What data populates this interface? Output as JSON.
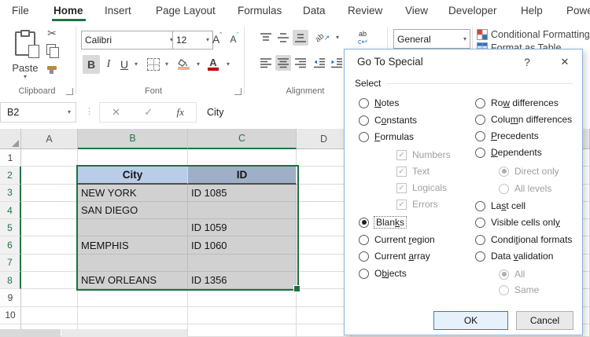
{
  "colors": {
    "excel_green": "#217346",
    "selection_gray": "#d1d1d1",
    "table_header_blue": "#b9cde9",
    "table_header_blue_selected": "#9fafc7",
    "ok_button_border": "#2a7fc6"
  },
  "icons": {
    "dropdown": "▾",
    "cut": "✂",
    "check": "✓",
    "cancel_x": "✕",
    "enter_check": "✓",
    "dots": "⋮",
    "fx": "fx",
    "help": "?",
    "close": "✕",
    "wrap_top": "ab",
    "wrap_bottom": "c↩",
    "orient": "ab"
  },
  "tabs": {
    "items": [
      "File",
      "Home",
      "Insert",
      "Page Layout",
      "Formulas",
      "Data",
      "Review",
      "View",
      "Developer",
      "Help",
      "Powe"
    ],
    "active": "Home"
  },
  "ribbon": {
    "clipboard_group": "Clipboard",
    "font_group": "Font",
    "alignment_group": "Alignment",
    "paste_label": "Paste",
    "font_name": "Calibri",
    "font_size": "12",
    "bold": "B",
    "italic": "I",
    "underline": "U",
    "grow_font": "A",
    "shrink_font": "A",
    "font_color": "A",
    "number_format": "General",
    "conditional_formatting": "Conditional Formatting",
    "format_as_table": "Format as Table"
  },
  "formula_bar": {
    "name_box": "B2",
    "value": "City"
  },
  "sheet": {
    "col_headers": [
      "A",
      "B",
      "C",
      "D"
    ],
    "selected_range": "B2:C8",
    "active_cell": "B2",
    "rows": [
      {
        "n": "1",
        "B": "",
        "C": ""
      },
      {
        "n": "2",
        "B": "City",
        "C": "ID"
      },
      {
        "n": "3",
        "B": "NEW YORK",
        "C": "ID 1085"
      },
      {
        "n": "4",
        "B": "SAN DIEGO",
        "C": ""
      },
      {
        "n": "5",
        "B": "",
        "C": "ID 1059"
      },
      {
        "n": "6",
        "B": "MEMPHIS",
        "C": "ID 1060"
      },
      {
        "n": "7",
        "B": "",
        "C": ""
      },
      {
        "n": "8",
        "B": "NEW ORLEANS",
        "C": "ID 1356"
      },
      {
        "n": "9",
        "B": "",
        "C": ""
      },
      {
        "n": "10",
        "B": "",
        "C": ""
      }
    ]
  },
  "dialog": {
    "title": "Go To Special",
    "select_label": "Select",
    "ok": "OK",
    "cancel": "Cancel",
    "left_options": [
      {
        "type": "radio",
        "state": "off",
        "enabled": true,
        "label": {
          "pre": "",
          "key": "N",
          "post": "otes"
        }
      },
      {
        "type": "radio",
        "state": "off",
        "enabled": true,
        "label": {
          "pre": "C",
          "key": "o",
          "post": "nstants"
        }
      },
      {
        "type": "radio",
        "state": "off",
        "enabled": true,
        "label": {
          "pre": "",
          "key": "F",
          "post": "ormulas"
        }
      },
      {
        "type": "checkbox",
        "state": "checked",
        "enabled": false,
        "label": "Numbers"
      },
      {
        "type": "checkbox",
        "state": "checked",
        "enabled": false,
        "label": "Text"
      },
      {
        "type": "checkbox",
        "state": "checked",
        "enabled": false,
        "label": "Logicals"
      },
      {
        "type": "checkbox",
        "state": "checked",
        "enabled": false,
        "label": "Errors"
      },
      {
        "type": "radio",
        "state": "on",
        "enabled": true,
        "focused": true,
        "label": {
          "pre": "Blan",
          "key": "k",
          "post": "s"
        }
      },
      {
        "type": "radio",
        "state": "off",
        "enabled": true,
        "label": {
          "pre": "Current ",
          "key": "r",
          "post": "egion"
        }
      },
      {
        "type": "radio",
        "state": "off",
        "enabled": true,
        "label": {
          "pre": "Current ",
          "key": "a",
          "post": "rray"
        }
      },
      {
        "type": "radio",
        "state": "off",
        "enabled": true,
        "label": {
          "pre": "O",
          "key": "b",
          "post": "jects"
        }
      }
    ],
    "right_options": [
      {
        "type": "radio",
        "state": "off",
        "enabled": true,
        "label": {
          "pre": "Ro",
          "key": "w",
          "post": " differences"
        }
      },
      {
        "type": "radio",
        "state": "off",
        "enabled": true,
        "label": {
          "pre": "Colu",
          "key": "m",
          "post": "n differences"
        }
      },
      {
        "type": "radio",
        "state": "off",
        "enabled": true,
        "label": {
          "pre": "",
          "key": "P",
          "post": "recedents"
        }
      },
      {
        "type": "radio",
        "state": "off",
        "enabled": true,
        "label": {
          "pre": "",
          "key": "D",
          "post": "ependents"
        }
      },
      {
        "type": "subradio",
        "state": "on",
        "enabled": false,
        "label": "Direct only"
      },
      {
        "type": "subradio",
        "state": "off",
        "enabled": false,
        "label": "All levels"
      },
      {
        "type": "radio",
        "state": "off",
        "enabled": true,
        "label": {
          "pre": "La",
          "key": "s",
          "post": "t cell"
        }
      },
      {
        "type": "radio",
        "state": "off",
        "enabled": true,
        "label": {
          "pre": "Visible cells onl",
          "key": "y",
          "post": ""
        }
      },
      {
        "type": "radio",
        "state": "off",
        "enabled": true,
        "label": {
          "pre": "Condi",
          "key": "t",
          "post": "ional formats"
        }
      },
      {
        "type": "radio",
        "state": "off",
        "enabled": true,
        "label": {
          "pre": "Data ",
          "key": "v",
          "post": "alidation"
        }
      },
      {
        "type": "subradio",
        "state": "on",
        "enabled": false,
        "label": "All"
      },
      {
        "type": "subradio",
        "state": "off",
        "enabled": false,
        "label": "Same"
      }
    ]
  }
}
